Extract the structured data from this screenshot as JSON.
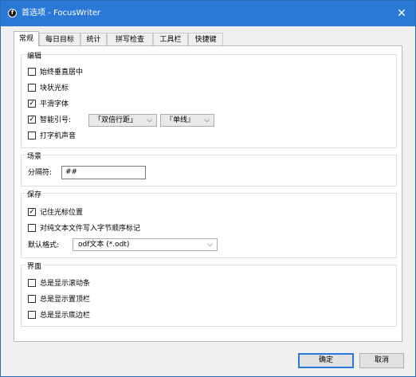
{
  "window": {
    "title": "首选项 - FocusWriter",
    "app_icon_glyph": "f",
    "close_glyph": "✕"
  },
  "tabs": [
    {
      "label": "常规"
    },
    {
      "label": "每日目标"
    },
    {
      "label": "统计"
    },
    {
      "label": "拼写检查"
    },
    {
      "label": "工具栏"
    },
    {
      "label": "快捷键"
    }
  ],
  "editing": {
    "title": "编辑",
    "always_center": {
      "label": "始终垂直居中",
      "checked": false
    },
    "block_cursor": {
      "label": "块状光标",
      "checked": false
    },
    "smooth_fonts": {
      "label": "平滑字体",
      "checked": true
    },
    "smart_quotes": {
      "label": "智能引号:",
      "checked": true
    },
    "double_quotes_value": "「双倍行距」",
    "single_quotes_value": "『单线』",
    "typewriter_sounds": {
      "label": "打字机声音",
      "checked": false
    }
  },
  "scenes": {
    "title": "场景",
    "divider_label": "分隔符:",
    "divider_value": "##"
  },
  "saving": {
    "title": "保存",
    "remember_cursor": {
      "label": "记住光标位置",
      "checked": true
    },
    "write_bom": {
      "label": "对纯文本文件写入字节顺序标记",
      "checked": false
    },
    "default_format_label": "默认格式:",
    "default_format_value": "odf文本 (*.odt)"
  },
  "interface": {
    "title": "界面",
    "show_scrollbar": {
      "label": "总是显示滚动条",
      "checked": false
    },
    "show_header": {
      "label": "总是显示置顶栏",
      "checked": false
    },
    "show_footer": {
      "label": "总是显示底边栏",
      "checked": false
    }
  },
  "buttons": {
    "ok": "确定",
    "cancel": "取消"
  },
  "glyphs": {
    "check": "✓",
    "chevron": "⌵"
  }
}
